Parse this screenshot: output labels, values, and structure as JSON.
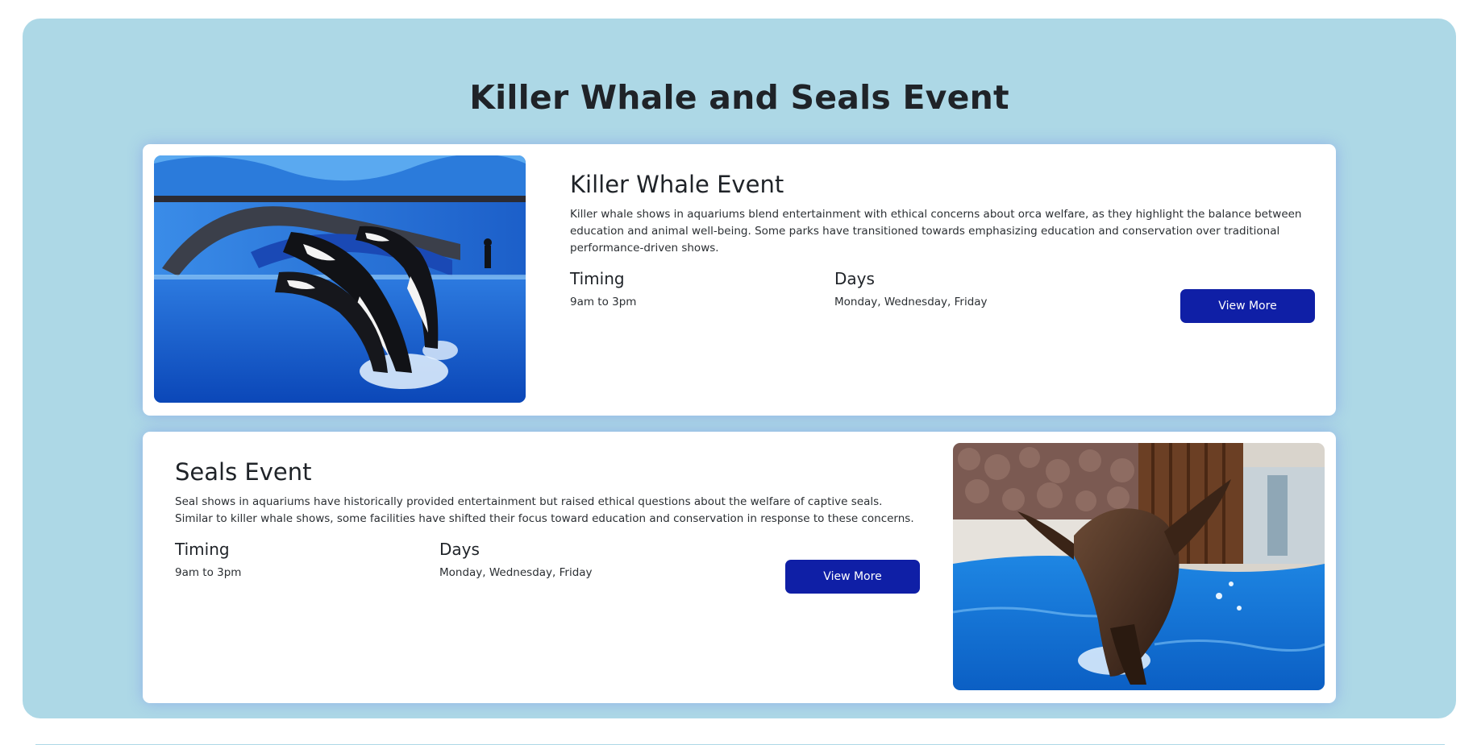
{
  "page": {
    "title": "Killer Whale and Seals Event"
  },
  "colors": {
    "panel_background": "#add8e6",
    "card_background": "#ffffff",
    "button_background": "#0f1fa6",
    "button_text": "#ffffff"
  },
  "events": [
    {
      "title": "Killer Whale Event",
      "description": "Killer whale shows in aquariums blend entertainment with ethical concerns about orca welfare, as they highlight the balance between education and animal well-being. Some parks have transitioned towards emphasizing education and conservation over traditional performance-driven shows.",
      "timing_label": "Timing",
      "timing_value": "9am to 3pm",
      "days_label": "Days",
      "days_value": "Monday, Wednesday, Friday",
      "button_label": "View More",
      "image_icon": "killer-whale-photo"
    },
    {
      "title": "Seals Event",
      "description": "Seal shows in aquariums have historically provided entertainment but raised ethical questions about the welfare of captive seals. Similar to killer whale shows, some facilities have shifted their focus toward education and conservation in response to these concerns.",
      "timing_label": "Timing",
      "timing_value": "9am to 3pm",
      "days_label": "Days",
      "days_value": "Monday, Wednesday, Friday",
      "button_label": "View More",
      "image_icon": "seal-photo"
    }
  ]
}
